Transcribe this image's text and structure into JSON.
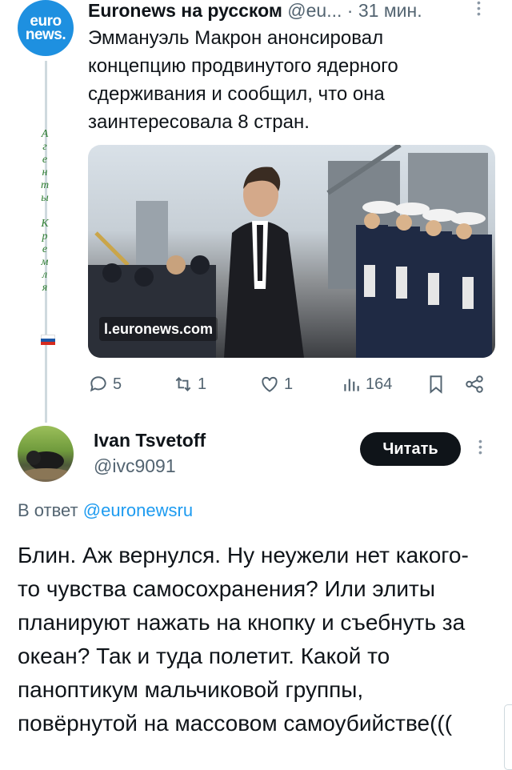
{
  "parent_tweet": {
    "avatar_text_line1": "euro",
    "avatar_text_line2": "news.",
    "author_name": "Euronews на русском",
    "author_handle": "@eu...",
    "separator": "·",
    "timestamp": "31 мин.",
    "text": "Эммануэль Макрон анонсировал концепцию продвинутого ядерного сдерживания и сообщил, что она заинтересовала 8 стран.",
    "side_label": "А\nг\nе\nн\nт\nы\n \nК\nр\nе\nм\nл\nя",
    "link_card_domain": "l.euronews.com",
    "actions": {
      "replies": "5",
      "reposts": "1",
      "likes": "1",
      "views": "164"
    }
  },
  "reply_tweet": {
    "author_name": "Ivan Tsvetoff",
    "author_handle": "@ivc9091",
    "follow_button_label": "Читать",
    "reply_to_prefix": "В ответ",
    "reply_to_mention": "@euronewsru",
    "text": "Блин. Аж вернулся. Ну неужели нет какого-то чувства самосохранения? Или элиты планируют нажать на кнопку и съебнуть за океан? Так и туда полетит. Какой то паноптикум мальчиковой группы, повёрнутой на массовом самоубийстве((("
  },
  "colors": {
    "euronews_blue": "#1e90e0",
    "link_blue": "#1d9bf0",
    "secondary_text": "#536471",
    "button_dark": "#0f1419"
  }
}
